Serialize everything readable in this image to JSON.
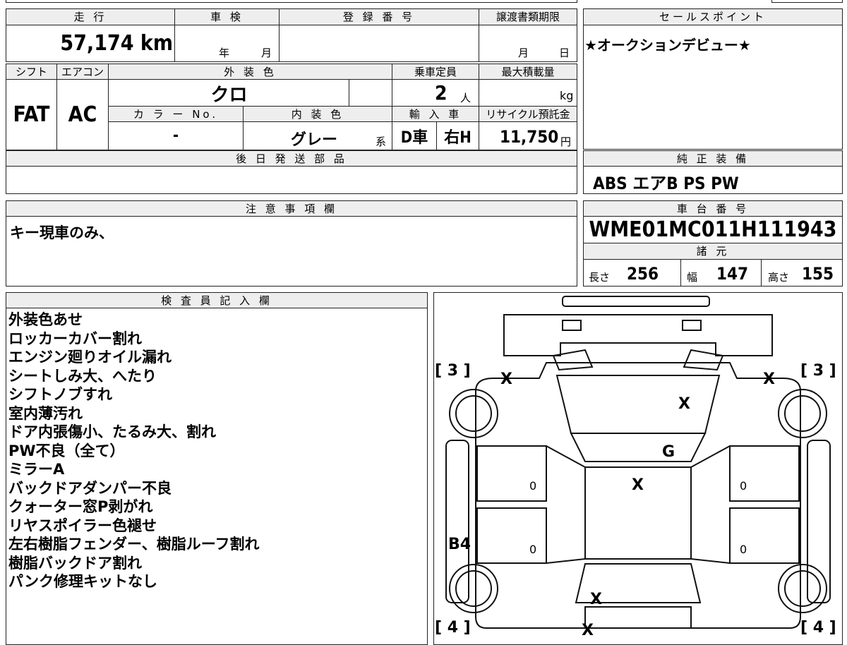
{
  "vehicle": {
    "mileage_label": "走 行",
    "mileage": "57,174",
    "mileage_unit": "km",
    "inspection_label": "車 検",
    "inspection_year": "年",
    "inspection_month": "月",
    "registration_label": "登 録 番 号",
    "transfer_label": "譲渡書類期限",
    "transfer_month": "月",
    "transfer_day": "日",
    "shift_label": "シフト",
    "shift": "FAT",
    "ac_label": "エアコン",
    "ac": "AC",
    "exterior_label": "外 装 色",
    "exterior": "クロ",
    "capacity_label": "乗車定員",
    "capacity": "2",
    "capacity_unit": "人",
    "load_label": "最大積載量",
    "load_unit": "kg",
    "color_no_label": "カ ラ ー No.",
    "color_no": "-",
    "interior_label": "内 装 色",
    "interior": "グレー",
    "interior_suffix": "系",
    "import_label": "輸 入 車",
    "import_d": "D車",
    "import_steer": "右H",
    "recycle_label": "リサイクル預託金",
    "recycle": "11,750",
    "recycle_unit": "円",
    "later_parts_label": "後 日 発 送 部 品",
    "later_parts": ""
  },
  "sales": {
    "label": "セールスポイント",
    "text": "★オークションデビュー★"
  },
  "equipment": {
    "label": "純 正 装 備",
    "text": "ABS エアB PS PW"
  },
  "notes": {
    "label": "注 意 事 項 欄",
    "text": "キー現車のみ、"
  },
  "chassis": {
    "label": "車 台 番 号",
    "number": "WME01MC011H111943",
    "spec_label": "諸 元",
    "length_label": "長さ",
    "length": "256",
    "width_label": "幅",
    "width": "147",
    "height_label": "高さ",
    "height": "155"
  },
  "inspector": {
    "label": "検 査 員 記 入 欄",
    "items": [
      "外装色あせ",
      "ロッカーカバー割れ",
      "エンジン廻りオイル漏れ",
      "シートしみ大、へたり",
      "シフトノブすれ",
      "室内薄汚れ",
      "ドア内張傷小、たるみ大、割れ",
      "PW不良（全て）",
      "ミラーA",
      "バックドアダンパー不良",
      "クォーター窓P剥がれ",
      "リヤスポイラー色褪せ",
      "左右樹脂フェンダー、樹脂ルーフ割れ",
      "樹脂バックドア割れ",
      "パンク修理キットなし"
    ]
  },
  "diagram": {
    "tire_front_left": "[ 3 ]",
    "tire_front_right": "[ 3 ]",
    "tire_rear_left": "[ 4 ]",
    "tire_rear_right": "[ 4 ]",
    "mark_front_left": "X",
    "mark_front_right": "X",
    "mark_hood": "X",
    "mark_windshield": "G",
    "mark_roof": "X",
    "mark_rear": "X",
    "mark_bottom": "X",
    "mark_left_side": "B4",
    "door_marks": [
      "0",
      "0",
      "0",
      "0"
    ]
  }
}
